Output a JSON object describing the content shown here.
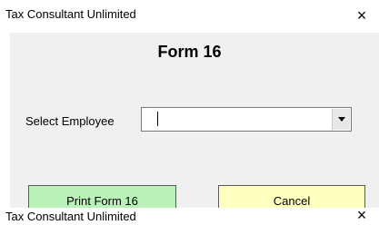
{
  "window": {
    "title": "Tax Consultant Unlimited",
    "close_glyph": "×",
    "close_icon": "close-icon"
  },
  "form": {
    "title": "Form 16",
    "employee_label": "Select Employee",
    "employee_value": "",
    "dropdown_icon": "chevron-down-icon"
  },
  "buttons": {
    "print_label": "Print Form 16",
    "cancel_label": "Cancel"
  },
  "second_window": {
    "title": "Tax Consultant Unlimited",
    "close_glyph": "×"
  },
  "colors": {
    "client_bg": "#f0f0f0",
    "print_button": "#b9f2b9",
    "cancel_button": "#ffffc0"
  }
}
